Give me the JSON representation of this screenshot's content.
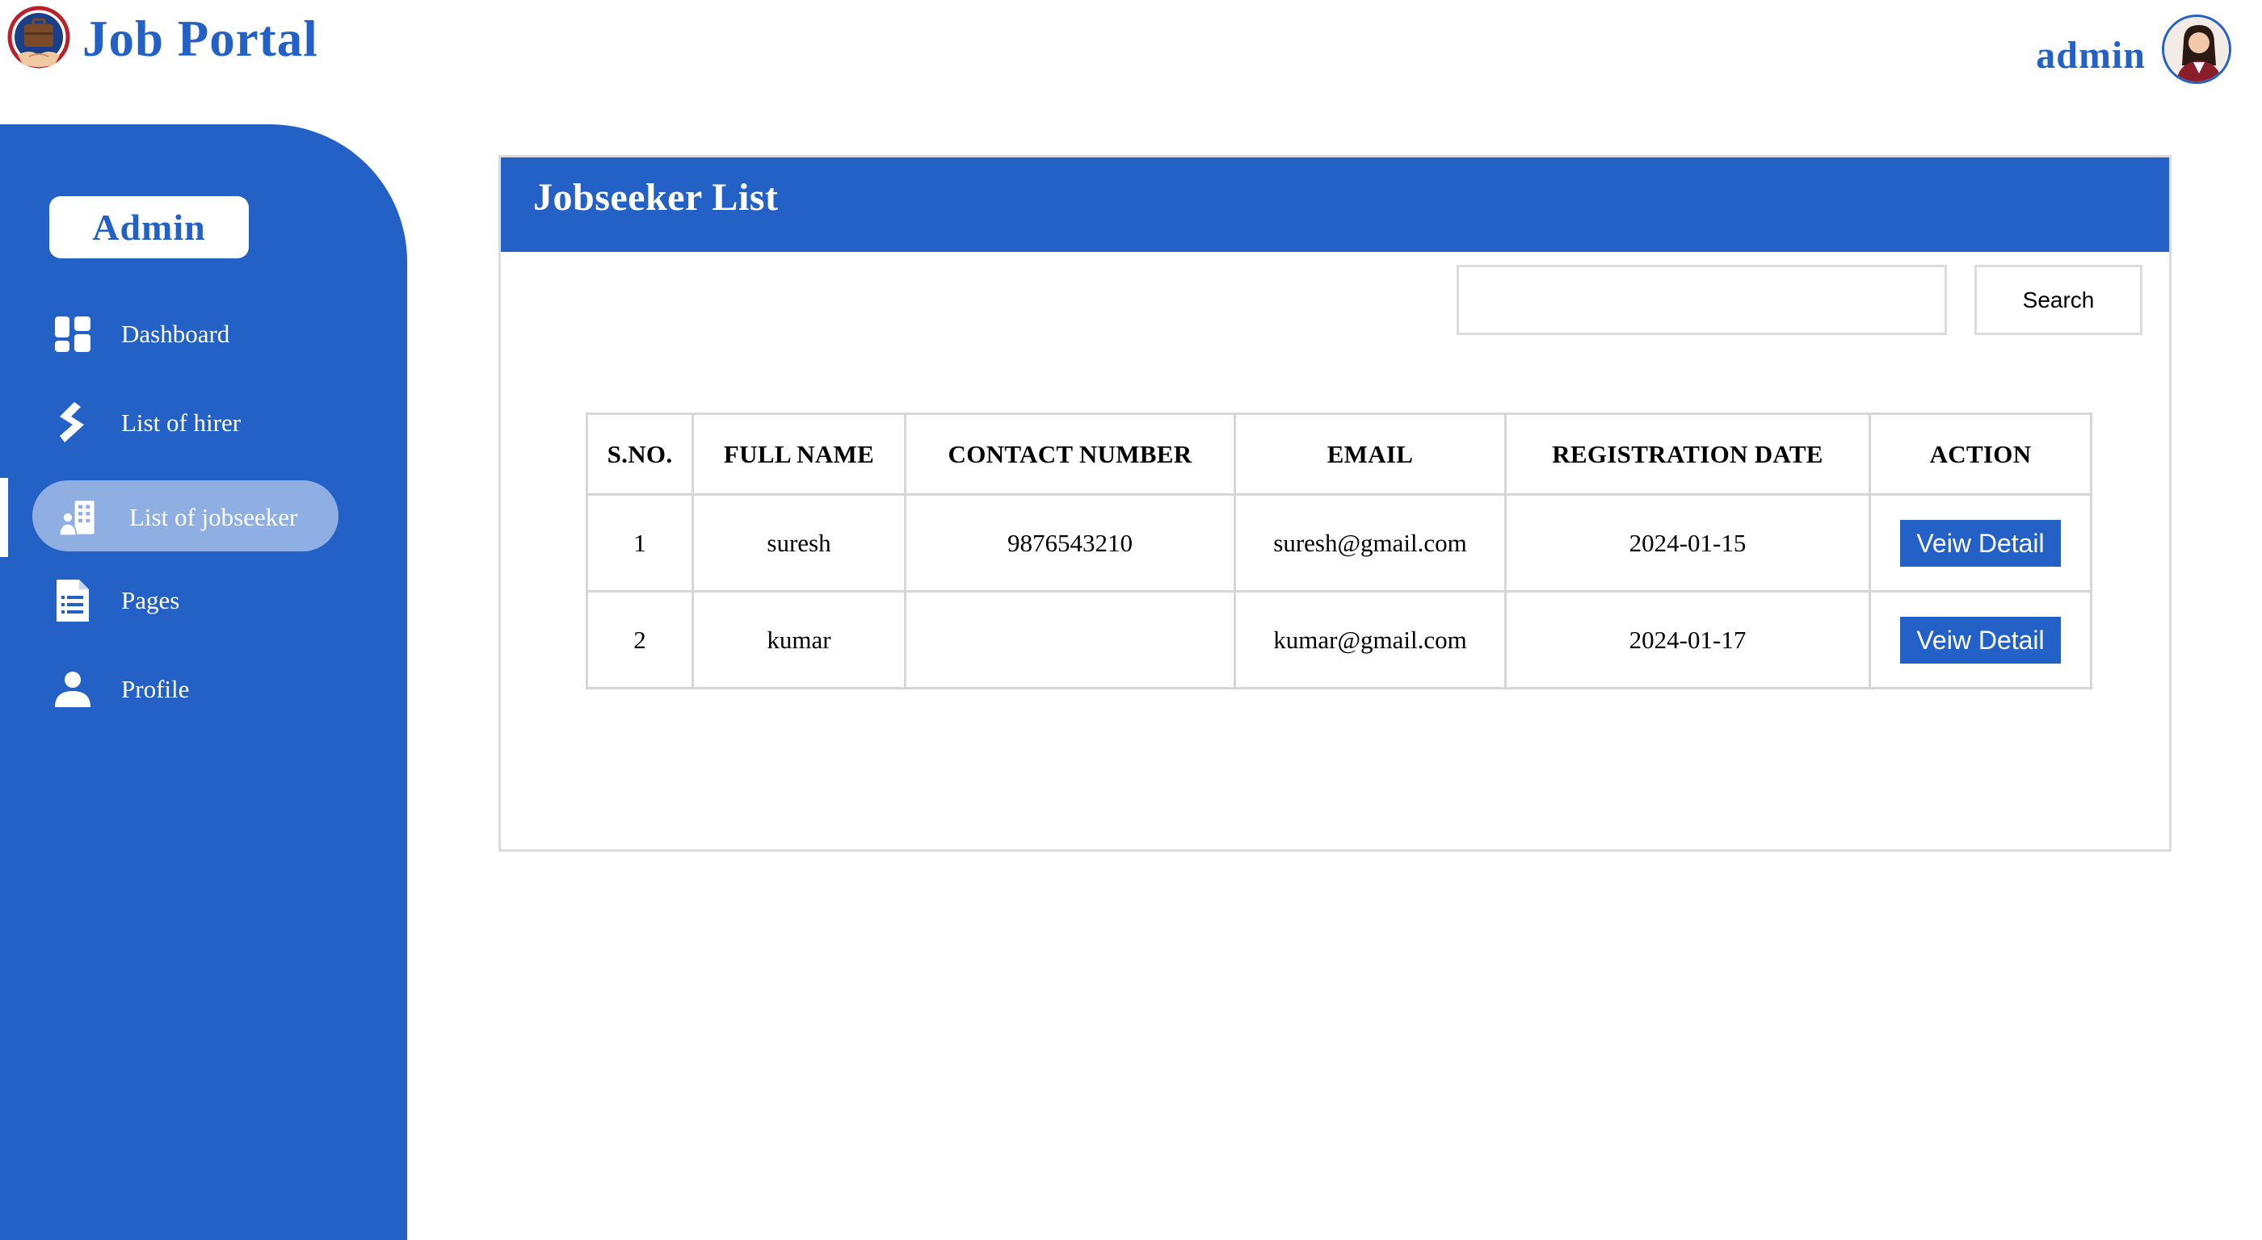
{
  "header": {
    "logo_text": "Job Portal",
    "logo_icon": "briefcase-handshake-logo",
    "user_name": "admin",
    "avatar": "user-avatar"
  },
  "sidebar": {
    "badge": "Admin",
    "items": [
      {
        "label": "Dashboard",
        "icon": "dashboard-icon"
      },
      {
        "label": "List of hirer",
        "icon": "hirer-icon"
      },
      {
        "label": "List of jobseeker",
        "icon": "jobseeker-icon",
        "active": true
      },
      {
        "label": "Pages",
        "icon": "document-icon"
      },
      {
        "label": "Profile",
        "icon": "user-icon"
      }
    ]
  },
  "main": {
    "title": "Jobseeker List",
    "search": {
      "value": "",
      "placeholder": "",
      "button_label": "Search"
    },
    "table": {
      "headers": [
        "S.NO.",
        "FULL NAME",
        "CONTACT NUMBER",
        "EMAIL",
        "REGISTRATION DATE",
        "ACTION"
      ],
      "rows": [
        {
          "sno": "1",
          "name": "suresh",
          "contact": "9876543210",
          "email": "suresh@gmail.com",
          "date": "2024-01-15",
          "action": "Veiw Detail"
        },
        {
          "sno": "2",
          "name": "kumar",
          "contact": "",
          "email": "kumar@gmail.com",
          "date": "2024-01-17",
          "action": "Veiw Detail"
        }
      ]
    }
  },
  "colors": {
    "primary": "#2461c6",
    "active_pill": "#8fafe3",
    "border": "#dcdcdc"
  }
}
